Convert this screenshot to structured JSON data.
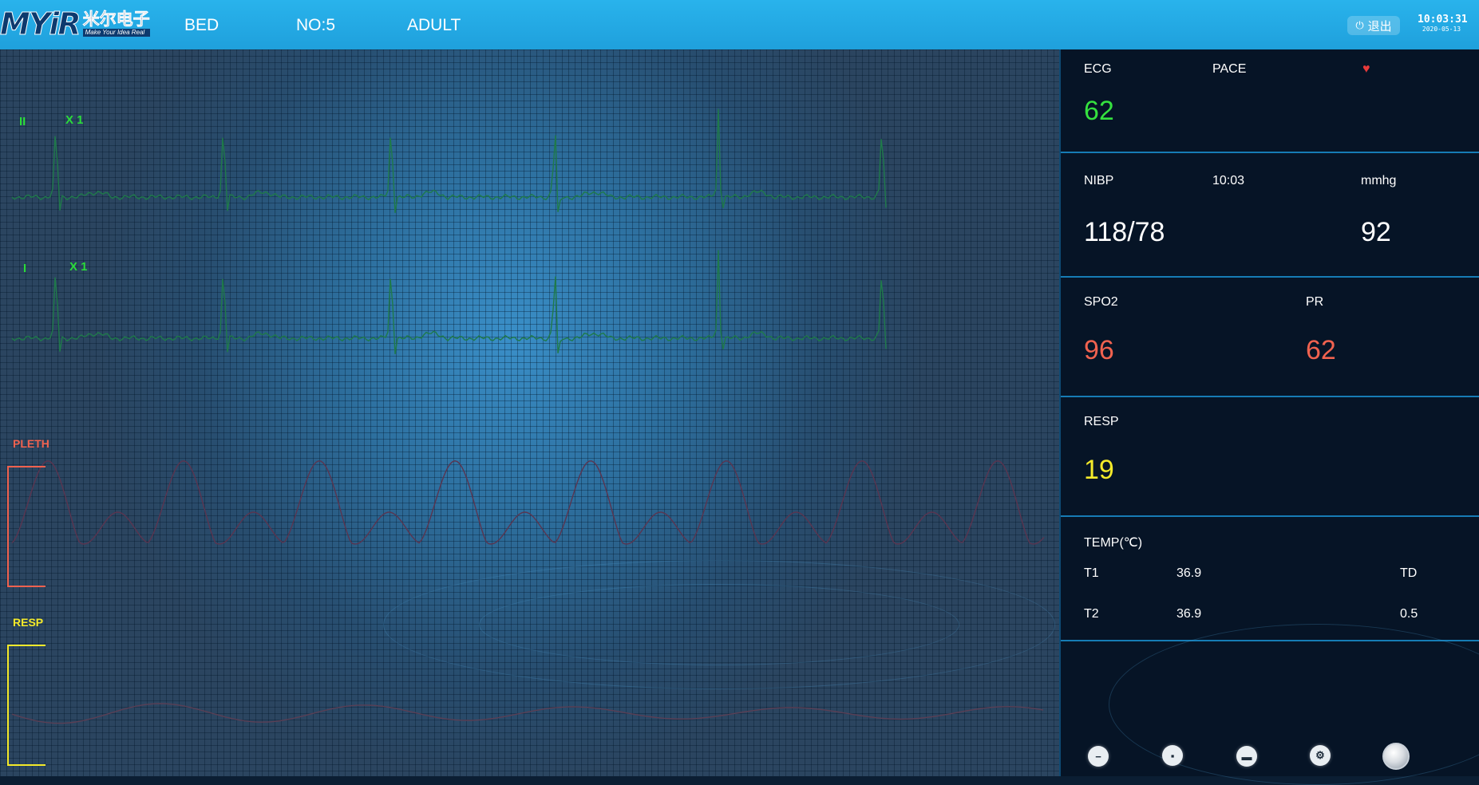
{
  "header": {
    "logo_text": "MYiR",
    "logo_cn": "米尔电子",
    "logo_tagline": "Make Your Idea Real",
    "bed_label": "BED",
    "number_label": "NO:5",
    "patient_type": "ADULT",
    "exit_label": "退出",
    "exit_icon": "power-icon",
    "time": "10:03:31",
    "date": "2020-05-13"
  },
  "waveforms": {
    "lead1_name": "II",
    "lead1_gain": "X 1",
    "lead2_name": "I",
    "lead2_gain": "X 1",
    "pleth_label": "PLETH",
    "resp_label": "RESP",
    "colors": {
      "ecg": "#1f7a4a",
      "lead_label": "#2bdc3a",
      "pleth": "#5a3550",
      "pleth_label": "#f0624f",
      "resp": "#5a3f55",
      "resp_label": "#f4ea2a"
    }
  },
  "panel": {
    "ecg": {
      "label": "ECG",
      "pace_label": "PACE",
      "heart_icon": "heart-icon",
      "value": "62"
    },
    "nibp": {
      "label": "NIBP",
      "time": "10:03",
      "unit": "mmhg",
      "value": "118/78",
      "mean": "92"
    },
    "spo2": {
      "label": "SPO2",
      "value": "96",
      "pr_label": "PR",
      "pr_value": "62"
    },
    "resp": {
      "label": "RESP",
      "value": "19"
    },
    "temp": {
      "label": "TEMP(℃)",
      "t1_label": "T1",
      "t1_value": "36.9",
      "t2_label": "T2",
      "t2_value": "36.9",
      "td_label": "TD",
      "td_value": "0.5"
    },
    "buttons": [
      {
        "icon": "minus-circle-icon",
        "glyph": "−"
      },
      {
        "icon": "save-icon",
        "glyph": "▪"
      },
      {
        "icon": "print-icon",
        "glyph": "▬"
      },
      {
        "icon": "gear-icon",
        "glyph": "⚙"
      },
      {
        "icon": "knob-icon",
        "glyph": ""
      }
    ]
  },
  "colors": {
    "header_bg": "#22a6e1",
    "panel_bg": "#061426",
    "panel_divider": "#167cb5",
    "ecg_value": "#35e13f",
    "spo2_value": "#f0624f",
    "resp_value": "#f4ea2a"
  }
}
